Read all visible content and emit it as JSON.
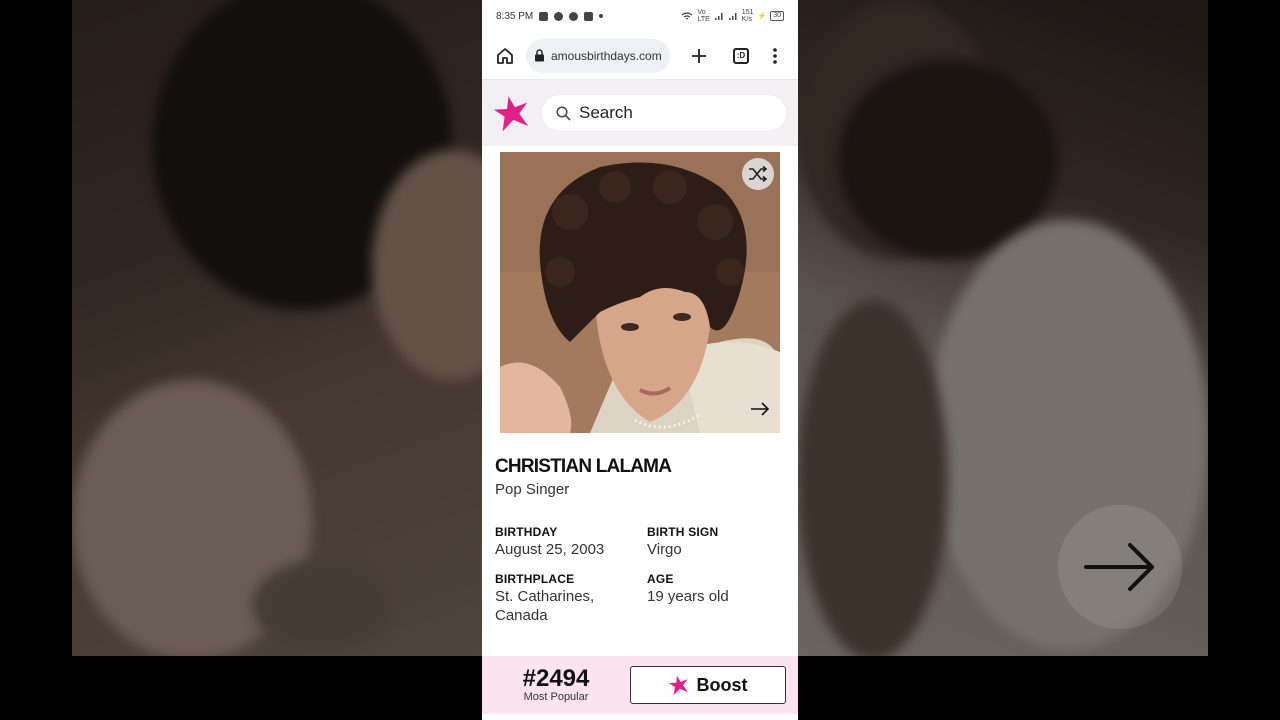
{
  "statusbar": {
    "time": "8:35 PM",
    "battery": "30"
  },
  "browser": {
    "url": "amousbirthdays.com",
    "tab_count": ":D"
  },
  "site": {
    "search_placeholder": "Search",
    "accent": "#e0218a"
  },
  "profile": {
    "name": "CHRISTIAN LALAMA",
    "profession": "Pop Singer",
    "facts": {
      "birthday_label": "BIRTHDAY",
      "birthday_value": "August 25, 2003",
      "birth_sign_label": "BIRTH SIGN",
      "birth_sign_value": "Virgo",
      "birthplace_label": "BIRTHPLACE",
      "birthplace_value": "St. Catharines, Canada",
      "age_label": "AGE",
      "age_value": "19 years old"
    }
  },
  "ranking": {
    "rank": "#2494",
    "rank_label": "Most Popular",
    "boost_label": "Boost"
  }
}
